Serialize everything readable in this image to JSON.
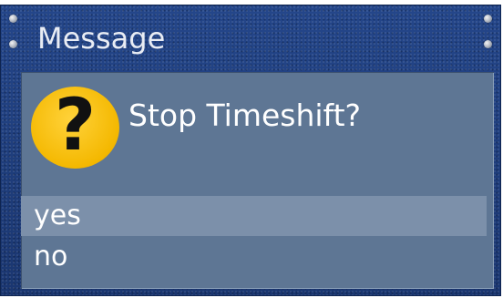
{
  "dialog": {
    "title": "Message",
    "icon": "question-mark-icon",
    "icon_glyph": "?",
    "question": "Stop Timeshift?",
    "options": [
      {
        "label": "yes",
        "selected": true
      },
      {
        "label": "no",
        "selected": false
      }
    ]
  },
  "colors": {
    "frame": "#1d3a75",
    "panel": "#5e7694",
    "selection": "#7c90aa",
    "icon": "#f4b800",
    "text": "#ffffff"
  }
}
